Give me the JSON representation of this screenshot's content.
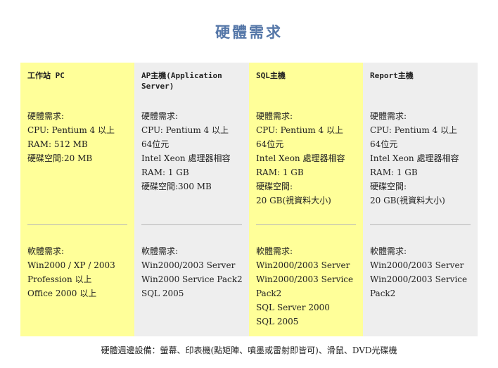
{
  "page_title": "硬體需求",
  "columns": [
    {
      "title": "工作站 PC",
      "hardware": [
        "硬體需求:",
        "CPU: Pentium 4 以上",
        "RAM: 512 MB",
        "硬碟空間:20 MB"
      ],
      "software": [
        "軟體需求:",
        "Win2000 / XP / 2003",
        "Profession 以上",
        "Office 2000 以上"
      ]
    },
    {
      "title": "AP主機(Application Server)",
      "hardware": [
        "硬體需求:",
        "CPU: Pentium 4 以上",
        "64位元",
        "Intel Xeon 處理器相容",
        "RAM: 1 GB",
        "硬碟空間:300 MB"
      ],
      "software": [
        "軟體需求:",
        "Win2000/2003 Server",
        "Win2000 Service Pack2",
        "SQL 2005"
      ]
    },
    {
      "title": "SQL主機",
      "hardware": [
        "硬體需求:",
        "CPU: Pentium 4 以上",
        "64位元",
        "Intel Xeon 處理器相容",
        "RAM: 1 GB",
        "硬碟空間:",
        "20 GB(視資料大小)"
      ],
      "software": [
        "軟體需求:",
        "Win2000/2003 Server",
        "Win2000/2003 Service",
        "Pack2",
        "SQL Server 2000",
        "SQL 2005"
      ]
    },
    {
      "title": "Report主機",
      "hardware": [
        "硬體需求:",
        "CPU: Pentium 4 以上",
        "64位元",
        "Intel Xeon 處理器相容",
        "RAM: 1 GB",
        "硬碟空間:",
        "20 GB(視資料大小)"
      ],
      "software": [
        "軟體需求:",
        "Win2000/2003 Server",
        "Win2000/2003 Service",
        "Pack2"
      ]
    }
  ],
  "footer": "硬體週邊設備：螢幕、印表機(點矩陣、噴墨或雷射即皆可)、滑鼠、DVD光碟機",
  "colors": {
    "title": "#5577a8",
    "yellow": "#ffff99",
    "gray": "#eeeeee"
  }
}
